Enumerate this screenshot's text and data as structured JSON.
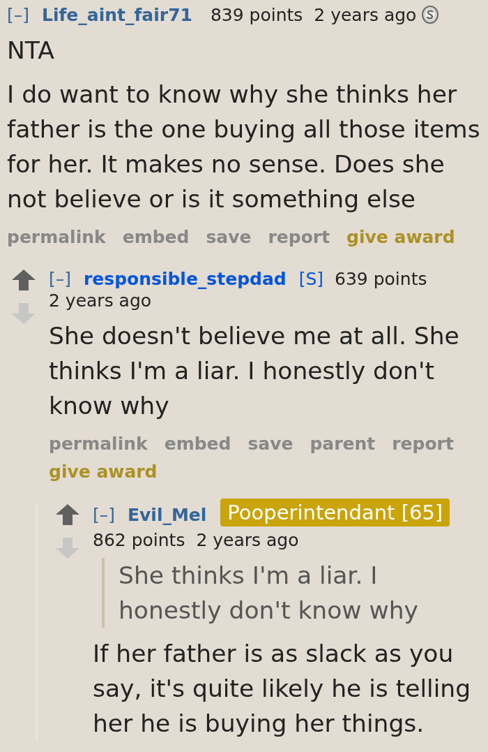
{
  "comments": [
    {
      "toggle": "[–]",
      "author": "Life_aint_fair71",
      "submitter": false,
      "score": "839 points",
      "time": "2 years ago",
      "awarded": true,
      "body": [
        {
          "kind": "paragraph",
          "text": "NTA"
        },
        {
          "kind": "paragraph",
          "text": "I do want to know why she thinks her father is the one buying all those items for her. It makes no sense. Does she not believe or is it something else"
        }
      ],
      "actions": [
        {
          "label": "permalink",
          "kind": "link"
        },
        {
          "label": "embed",
          "kind": "link"
        },
        {
          "label": "save",
          "kind": "link"
        },
        {
          "label": "report",
          "kind": "link"
        },
        {
          "label": "give award",
          "kind": "award"
        }
      ],
      "children": [
        {
          "toggle": "[–]",
          "author": "responsible_stepdad",
          "submitter": true,
          "submitter_tag": "[S]",
          "score": "639 points",
          "time": "2 years ago",
          "body": [
            {
              "kind": "paragraph",
              "text": "She doesn't believe me at all. She thinks I'm a liar. I honestly don't know why"
            }
          ],
          "actions": [
            {
              "label": "permalink",
              "kind": "link"
            },
            {
              "label": "embed",
              "kind": "link"
            },
            {
              "label": "save",
              "kind": "link"
            },
            {
              "label": "parent",
              "kind": "link"
            },
            {
              "label": "report",
              "kind": "link"
            },
            {
              "label": "give award",
              "kind": "award"
            }
          ],
          "children": [
            {
              "toggle": "[–]",
              "author": "Evil_Mel",
              "submitter": false,
              "flair": "Pooperintendant [65]",
              "score": "862 points",
              "time": "2 years ago",
              "body": [
                {
                  "kind": "quote",
                  "text": "She thinks I'm a liar. I honestly don't know why"
                },
                {
                  "kind": "paragraph",
                  "text": "If her father is as slack as you say, it's quite likely he is telling her he is buying her things."
                }
              ]
            }
          ]
        }
      ]
    }
  ]
}
